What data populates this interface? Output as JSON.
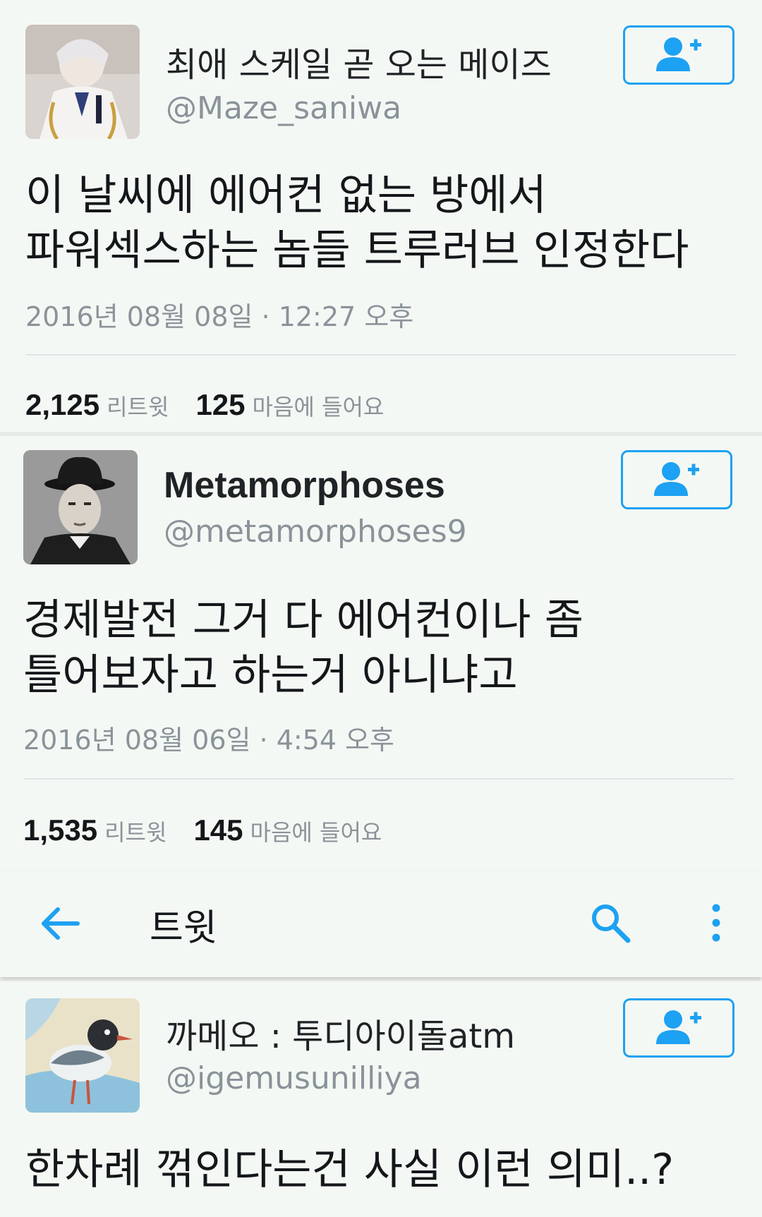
{
  "tweets": [
    {
      "display_name": "최애 스케일 곧 오는 메이즈",
      "handle": "@Maze_saniwa",
      "text_line1": "이 날씨에 에어컨 없는 방에서",
      "text_line2": "파워섹스하는 놈들 트루러브 인정한다",
      "timestamp": "2016년 08월 08일 · 12:27 오후",
      "retweets": "2,125",
      "retweets_label": "리트윗",
      "likes": "125",
      "likes_label": "마음에 들어요"
    },
    {
      "display_name": "Metamorphoses",
      "handle": "@metamorphoses9",
      "text_line1": "경제발전 그거 다 에어컨이나 좀",
      "text_line2": "틀어보자고 하는거 아니냐고",
      "timestamp": "2016년 08월 06일 · 4:54 오후",
      "retweets": "1,535",
      "retweets_label": "리트윗",
      "likes": "145",
      "likes_label": "마음에 들어요"
    },
    {
      "display_name": "까메오 : 투디아이돌atm",
      "handle": "@igemusunilliya",
      "text_line1": "한차례 꺾인다는건 사실 이런 의미..?"
    }
  ],
  "toolbar": {
    "title": "트윗",
    "back_icon": "arrow-left-icon",
    "search_icon": "search-icon",
    "more_icon": "more-vertical-icon"
  },
  "colors": {
    "accent": "#1da1f2",
    "background": "#f4f8f4",
    "muted_text": "#8a9399"
  }
}
